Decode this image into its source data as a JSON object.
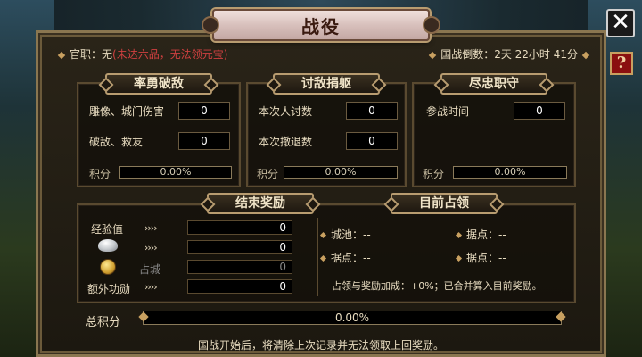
{
  "title": "战役",
  "header": {
    "rank_label": "官职：无",
    "rank_warning": "(未达六品，无法领元宝)",
    "countdown": "国战倒数：2天 22小时 41分"
  },
  "panels": {
    "bravery": {
      "title": "率勇破敌",
      "rows": [
        {
          "label": "雕像、城门伤害",
          "value": "0"
        },
        {
          "label": "破敌、救友",
          "value": "0"
        }
      ],
      "score_label": "积分",
      "score": "0.00%"
    },
    "punish": {
      "title": "讨敌捐躯",
      "rows": [
        {
          "label": "本次人讨数",
          "value": "0"
        },
        {
          "label": "本次撤退数",
          "value": "0"
        }
      ],
      "score_label": "积分",
      "score": "0.00%"
    },
    "loyalty": {
      "title": "尽忠职守",
      "rows": [
        {
          "label": "参战时间",
          "value": "0"
        }
      ],
      "score_label": "积分",
      "score": "0.00%"
    },
    "rewards": {
      "title": "结束奖励",
      "arrows": "››››",
      "items": [
        {
          "label": "经验值",
          "value": "0",
          "icon": "experience"
        },
        {
          "label": "",
          "value": "0",
          "icon": "silver-ingot-icon"
        },
        {
          "label": "占城",
          "value": "0",
          "icon": "gold-coin-icon",
          "dim": true
        },
        {
          "label": "额外功勋",
          "value": "0",
          "icon": "merit"
        }
      ]
    },
    "occupation": {
      "title": "目前占领",
      "items": [
        {
          "label": "城池：--"
        },
        {
          "label": "据点：--"
        },
        {
          "label": "据点：--"
        },
        {
          "label": "据点：--"
        }
      ],
      "note": "占领与奖励加成：+0%；已合并算入目前奖励。"
    }
  },
  "total": {
    "label": "总积分",
    "value": "0.00%"
  },
  "footer": "国战开始后，将清除上次记录并无法领取上回奖励。",
  "buttons": {
    "close": "✕",
    "help": "?"
  },
  "colors": {
    "accent_gold": "#b89c70",
    "warning_red": "#d04040"
  }
}
